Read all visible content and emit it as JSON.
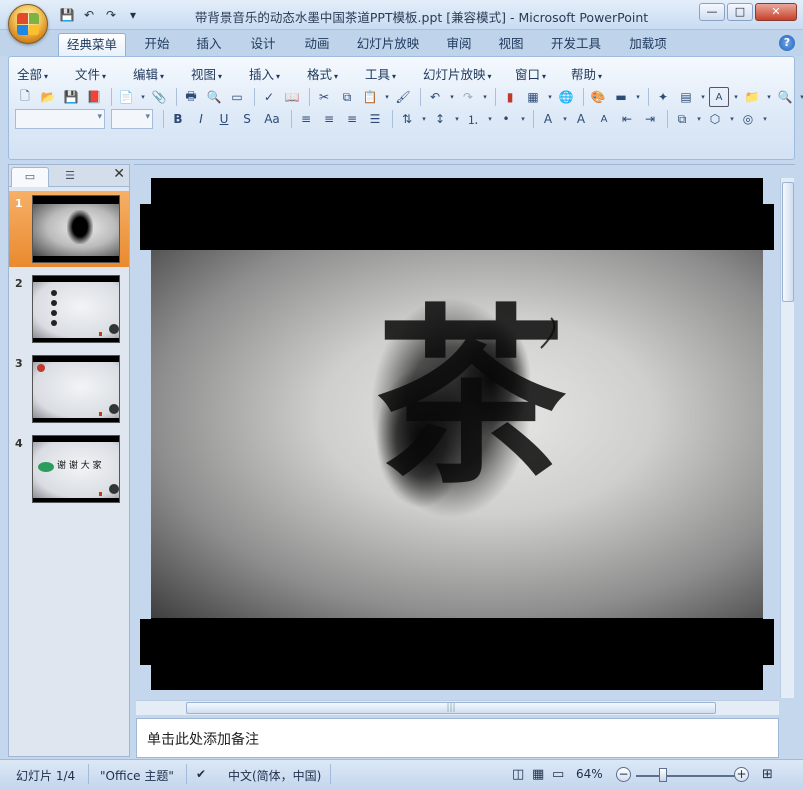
{
  "window": {
    "title": "带背景音乐的动态水墨中国茶道PPT模板.ppt [兼容模式] - Microsoft PowerPoint",
    "controls": {
      "minimize": "—",
      "maximize": "□",
      "close": "✕"
    }
  },
  "ribbon_tabs": [
    "经典菜单",
    "开始",
    "插入",
    "设计",
    "动画",
    "幻灯片放映",
    "审阅",
    "视图",
    "开发工具",
    "加载项"
  ],
  "classic_menu": [
    "全部",
    "文件",
    "编辑",
    "视图",
    "插入",
    "格式",
    "工具",
    "幻灯片放映",
    "窗口",
    "帮助"
  ],
  "toolbar": {
    "bold": "B",
    "italic": "I",
    "underline": "U",
    "shadow": "S",
    "case": "Aa",
    "font_color_label": "A",
    "text_box_label": "A"
  },
  "slides_panel": {
    "close": "✕",
    "slides": [
      {
        "number": "1",
        "selected": true
      },
      {
        "number": "2",
        "selected": false
      },
      {
        "number": "3",
        "selected": false
      },
      {
        "number": "4",
        "selected": false,
        "caption": "谢 谢 大 家"
      }
    ]
  },
  "slide": {
    "calligraphy_char": "茶"
  },
  "notes": {
    "placeholder": "单击此处添加备注"
  },
  "status_bar": {
    "slide_position": "幻灯片 1/4",
    "theme": "\"Office 主题\"",
    "language": "中文(简体，中国)",
    "zoom": "64%",
    "zoom_out": "−",
    "zoom_in": "+"
  },
  "colors": {
    "selected_thumb": "#e98a2e",
    "ribbon_bg": "#dde9f7",
    "slide_band": "#000000"
  },
  "icons": {
    "qat": [
      "save-icon",
      "undo-icon",
      "redo-icon",
      "customize-icon"
    ],
    "toolbar_row1": [
      "new-icon",
      "open-icon",
      "save-icon",
      "pdf-icon",
      "permission-icon",
      "attach-icon",
      "print-icon",
      "print-preview-icon",
      "spellcheck-icon",
      "research-icon",
      "cut-icon",
      "copy-icon",
      "paste-icon",
      "format-painter-icon",
      "undo-icon",
      "redo-icon",
      "chart-icon",
      "table-icon",
      "hyperlink-icon",
      "color-icon",
      "fill-icon",
      "new-slide-icon",
      "layout-icon",
      "textbox-icon",
      "folder-icon",
      "find-icon"
    ]
  }
}
